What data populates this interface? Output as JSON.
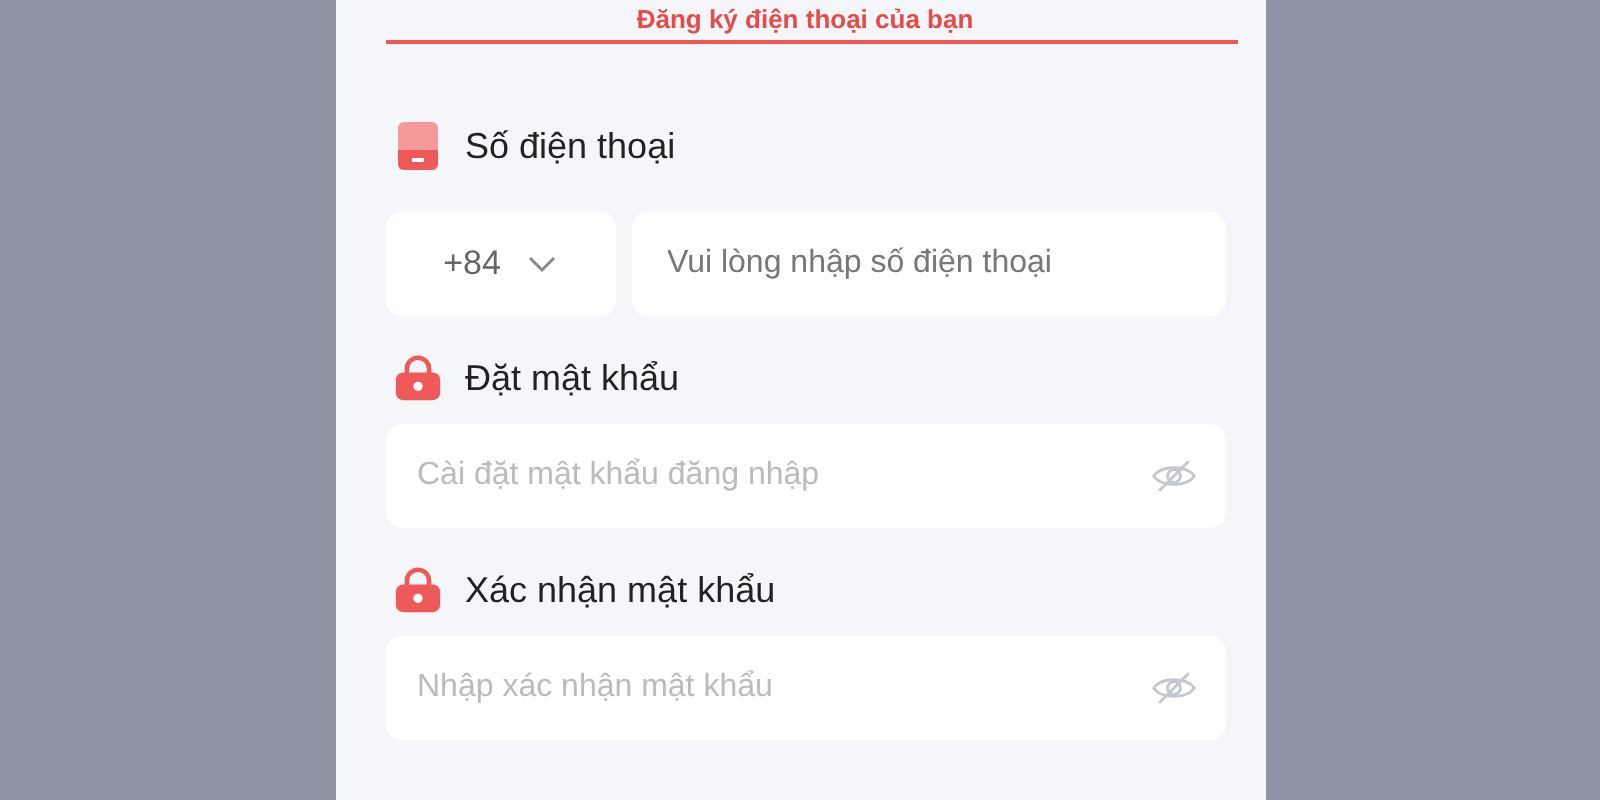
{
  "form": {
    "title": "Đăng ký điện thoại của bạn",
    "fields": [
      {
        "kind": "phone",
        "label": "Số điện thoại",
        "country_code": "+84",
        "placeholder": "Vui lòng nhập số điện thoại"
      },
      {
        "kind": "password",
        "label": "Đặt mật khẩu",
        "placeholder": "Cài đặt mật khẩu đăng nhập"
      },
      {
        "kind": "password",
        "label": "Xác nhận mật khẩu",
        "placeholder": "Nhập xác nhận mật khẩu"
      }
    ]
  }
}
